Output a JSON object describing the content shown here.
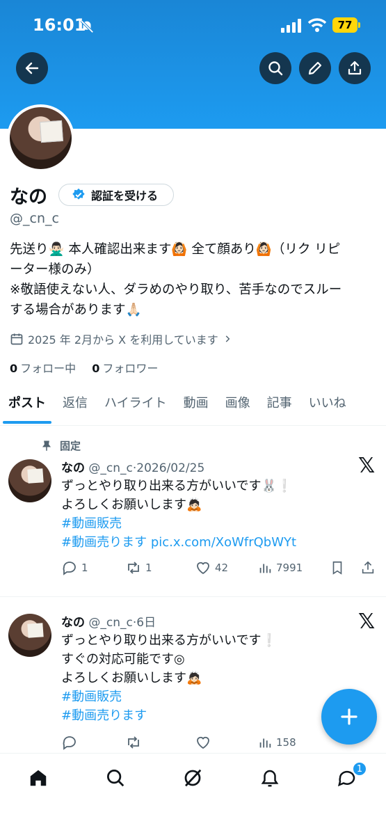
{
  "status_bar": {
    "time": "16:01",
    "battery": "77"
  },
  "profile": {
    "name": "なの",
    "verify_button": "認証を受ける",
    "handle": "@_cn_c",
    "bio_lines": [
      "先送り🙅🏻‍♂️ 本人確認出来ます🙆🏻 全て顔あり🙆🏻（リク リピ",
      "ーター様のみ）",
      "※敬語使えない人、ダラめのやり取り、苦手なのでスルー",
      "する場合があります🙏🏻"
    ],
    "joined": "2025 年 2月から X を利用しています",
    "following_count": "0",
    "following_label": "フォロー中",
    "followers_count": "0",
    "followers_label": "フォロワー"
  },
  "tabs": [
    "ポスト",
    "返信",
    "ハイライト",
    "動画",
    "画像",
    "記事",
    "いいね"
  ],
  "pinned_label": "固定",
  "tweets": [
    {
      "name": "なの",
      "handle": "@_cn_c",
      "date": "2026/02/25",
      "lines": [
        "ずっとやり取り出来る方がいいです🐰❕",
        "よろしくお願いします🙇🏻"
      ],
      "tags": [
        "#動画販売",
        "#動画売ります"
      ],
      "link": "pic.x.com/XoWfrQbWYt",
      "replies": "1",
      "retweets": "1",
      "likes": "42",
      "views": "7991"
    },
    {
      "name": "なの",
      "handle": "@_cn_c",
      "date": "6日",
      "lines": [
        "ずっとやり取り出来る方がいいです❕",
        "すぐの対応可能です◎",
        "よろしくお願いします🙇🏻"
      ],
      "tags": [
        "#動画販売",
        "#動画売ります"
      ],
      "views": "158"
    }
  ],
  "notifications_badge": "1",
  "colors": {
    "accent": "#1d9bf0",
    "banner": "#1d9bf0"
  }
}
